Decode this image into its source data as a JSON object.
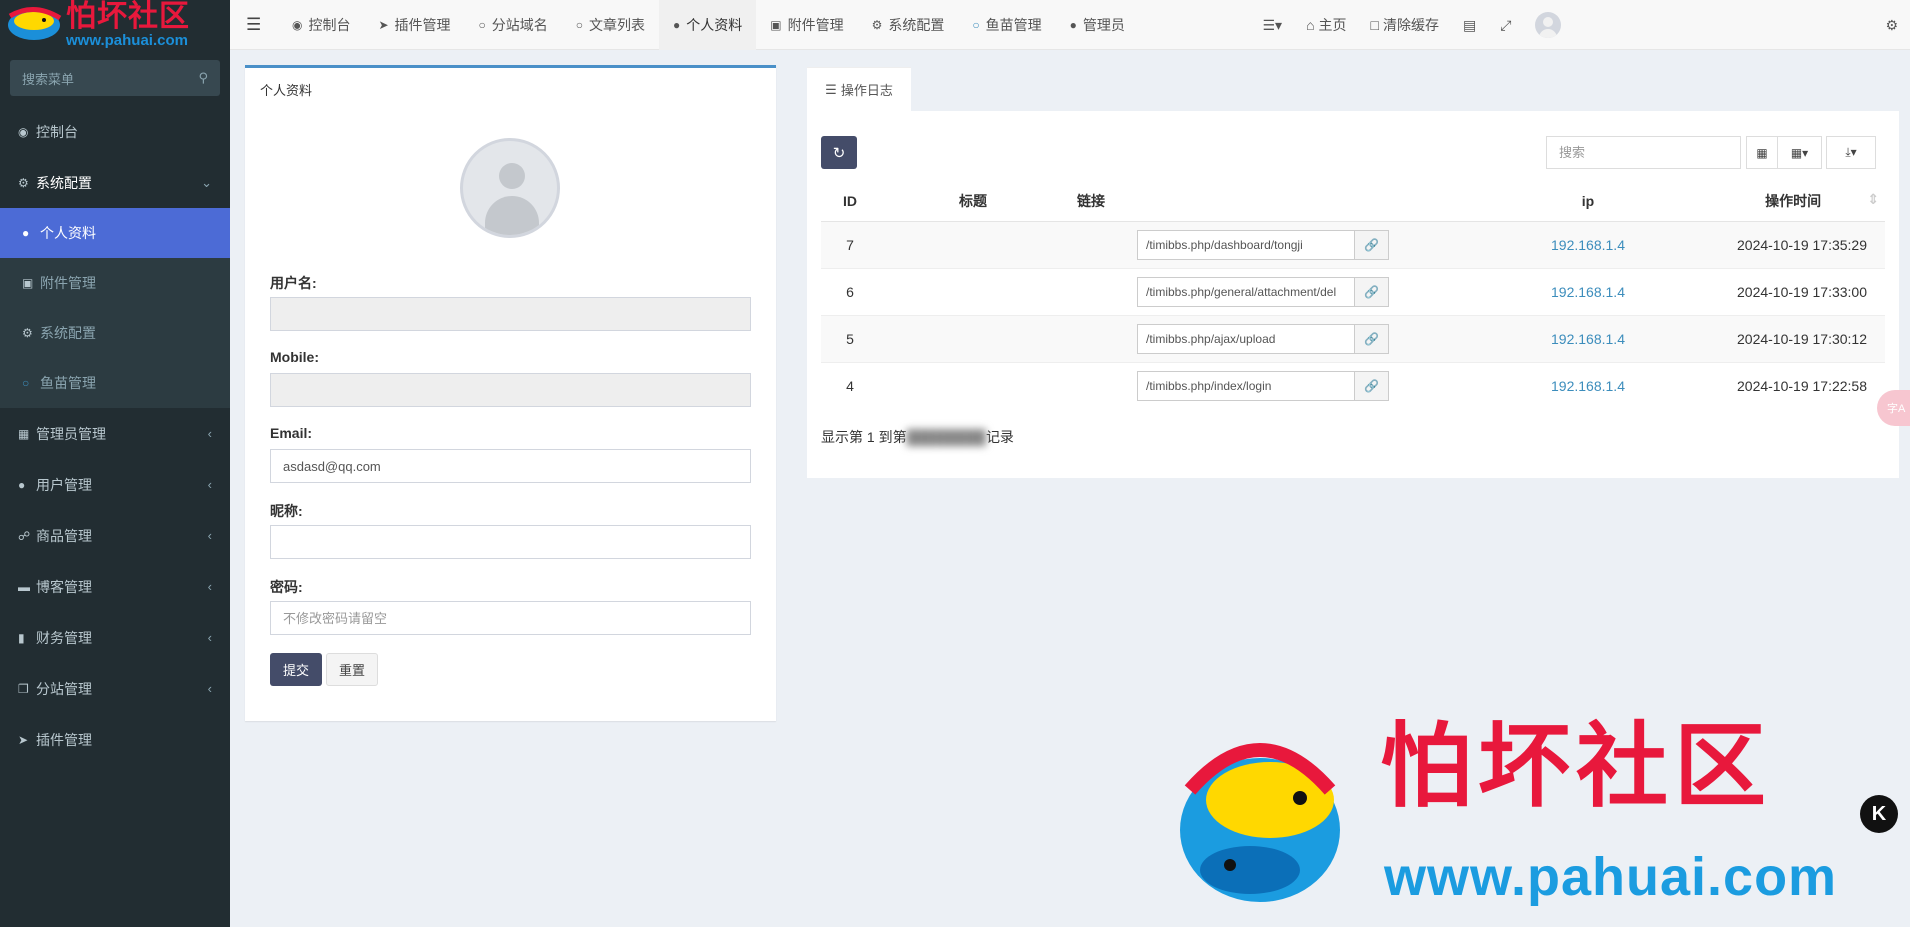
{
  "logo": {
    "cn": "怕坏社区",
    "url": "www.pahuai.com"
  },
  "sidebar": {
    "search_placeholder": "搜索菜单",
    "items": [
      {
        "label": "控制台",
        "icon": "dashboard-icon"
      },
      {
        "label": "系统配置",
        "icon": "cogs-icon",
        "expanded": true
      },
      {
        "label": "个人资料",
        "icon": "user-icon",
        "sub": true,
        "active": true
      },
      {
        "label": "附件管理",
        "icon": "image-icon",
        "sub": true
      },
      {
        "label": "系统配置",
        "icon": "gear-icon",
        "sub": true
      },
      {
        "label": "鱼苗管理",
        "icon": "fish-icon",
        "sub": true
      },
      {
        "label": "管理员管理",
        "icon": "windows-icon"
      },
      {
        "label": "用户管理",
        "icon": "user-icon"
      },
      {
        "label": "商品管理",
        "icon": "cart-icon"
      },
      {
        "label": "博客管理",
        "icon": "book-icon"
      },
      {
        "label": "财务管理",
        "icon": "bookmark-icon"
      },
      {
        "label": "分站管理",
        "icon": "window-restore-icon"
      },
      {
        "label": "插件管理",
        "icon": "rocket-icon"
      }
    ]
  },
  "header": {
    "tabs": [
      "控制台",
      "插件管理",
      "分站域名",
      "文章列表",
      "个人资料",
      "附件管理",
      "系统配置",
      "鱼苗管理",
      "管理员"
    ],
    "home": "主页",
    "clear_cache": "清除缓存"
  },
  "profile": {
    "title": "个人资料",
    "username_label": "用户名:",
    "username_value": "",
    "mobile_label": "Mobile:",
    "mobile_value": "",
    "email_label": "Email:",
    "email_value": "asdasd@qq.com",
    "nickname_label": "昵称:",
    "nickname_value": "",
    "password_label": "密码:",
    "password_placeholder": "不修改密码请留空",
    "submit": "提交",
    "reset": "重置"
  },
  "log": {
    "tab": "操作日志",
    "search_placeholder": "搜索",
    "columns": {
      "id": "ID",
      "title": "标题",
      "link": "链接",
      "ip": "ip",
      "time": "操作时间"
    },
    "rows": [
      {
        "id": "7",
        "url": "/timibbs.php/dashboard/tongji",
        "ip": "192.168.1.4",
        "time": "2024-10-19 17:35:29"
      },
      {
        "id": "6",
        "url": "/timibbs.php/general/attachment/del",
        "ip": "192.168.1.4",
        "time": "2024-10-19 17:33:00"
      },
      {
        "id": "5",
        "url": "/timibbs.php/ajax/upload",
        "ip": "192.168.1.4",
        "time": "2024-10-19 17:30:12"
      },
      {
        "id": "4",
        "url": "/timibbs.php/index/login",
        "ip": "192.168.1.4",
        "time": "2024-10-19 17:22:58"
      }
    ],
    "pager_prefix": "显示第 1 到第",
    "pager_suffix": "记录"
  },
  "watermark": {
    "cn": "怕坏社区",
    "url": "www.pahuai.com",
    "badge": "K"
  },
  "colors": {
    "sidebar": "#222d32",
    "active": "#4c6bd6",
    "primary_btn": "#444c69",
    "link": "#3c8dbc",
    "brand_red": "#e8183c",
    "brand_blue": "#1b9ce0"
  }
}
